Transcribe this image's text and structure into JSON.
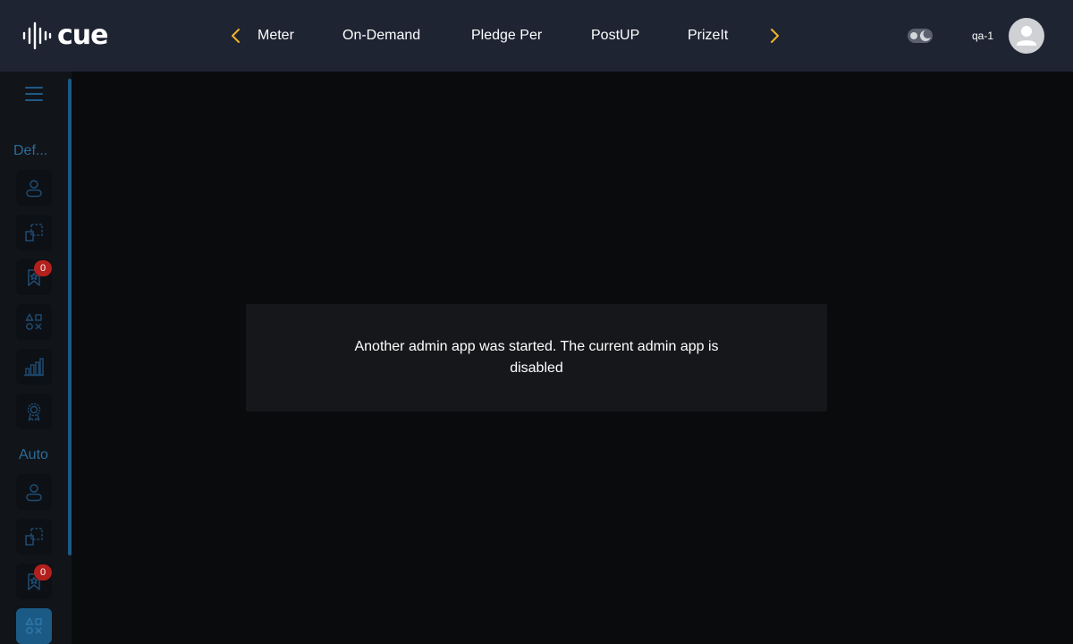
{
  "brand": {
    "logo_text": "cue"
  },
  "colors": {
    "topbar_bg": "#1f2433",
    "sidebar_icon": "#1f4c73",
    "accent_arrow": "#f0b429",
    "badge": "#b3201c",
    "active_item": "#1b5a85"
  },
  "nav": {
    "prev_icon": "chevron-left-icon",
    "next_icon": "chevron-right-icon",
    "tabs": [
      {
        "label": "Meter"
      },
      {
        "label": "On-Demand"
      },
      {
        "label": "Pledge Per"
      },
      {
        "label": "PostUP"
      },
      {
        "label": "PrizeIt"
      }
    ]
  },
  "user": {
    "name": "qa-1",
    "theme_toggle_icon": "moon-toggle-icon"
  },
  "sidebar": {
    "menu_icon": "hamburger-icon",
    "sections": [
      {
        "label": "Def...",
        "items": [
          {
            "icon": "user-icon"
          },
          {
            "icon": "layers-icon"
          },
          {
            "icon": "bookmark-star-icon",
            "badge": "0"
          },
          {
            "icon": "shapes-icon"
          },
          {
            "icon": "bar-chart-icon"
          },
          {
            "icon": "award-icon"
          }
        ]
      },
      {
        "label": "Auto",
        "items": [
          {
            "icon": "user-icon"
          },
          {
            "icon": "layers-icon"
          },
          {
            "icon": "bookmark-star-icon",
            "badge": "0"
          },
          {
            "icon": "shapes-icon",
            "active": true
          }
        ]
      }
    ]
  },
  "dialog": {
    "message": "Another admin app was started. The current admin app is disabled"
  }
}
